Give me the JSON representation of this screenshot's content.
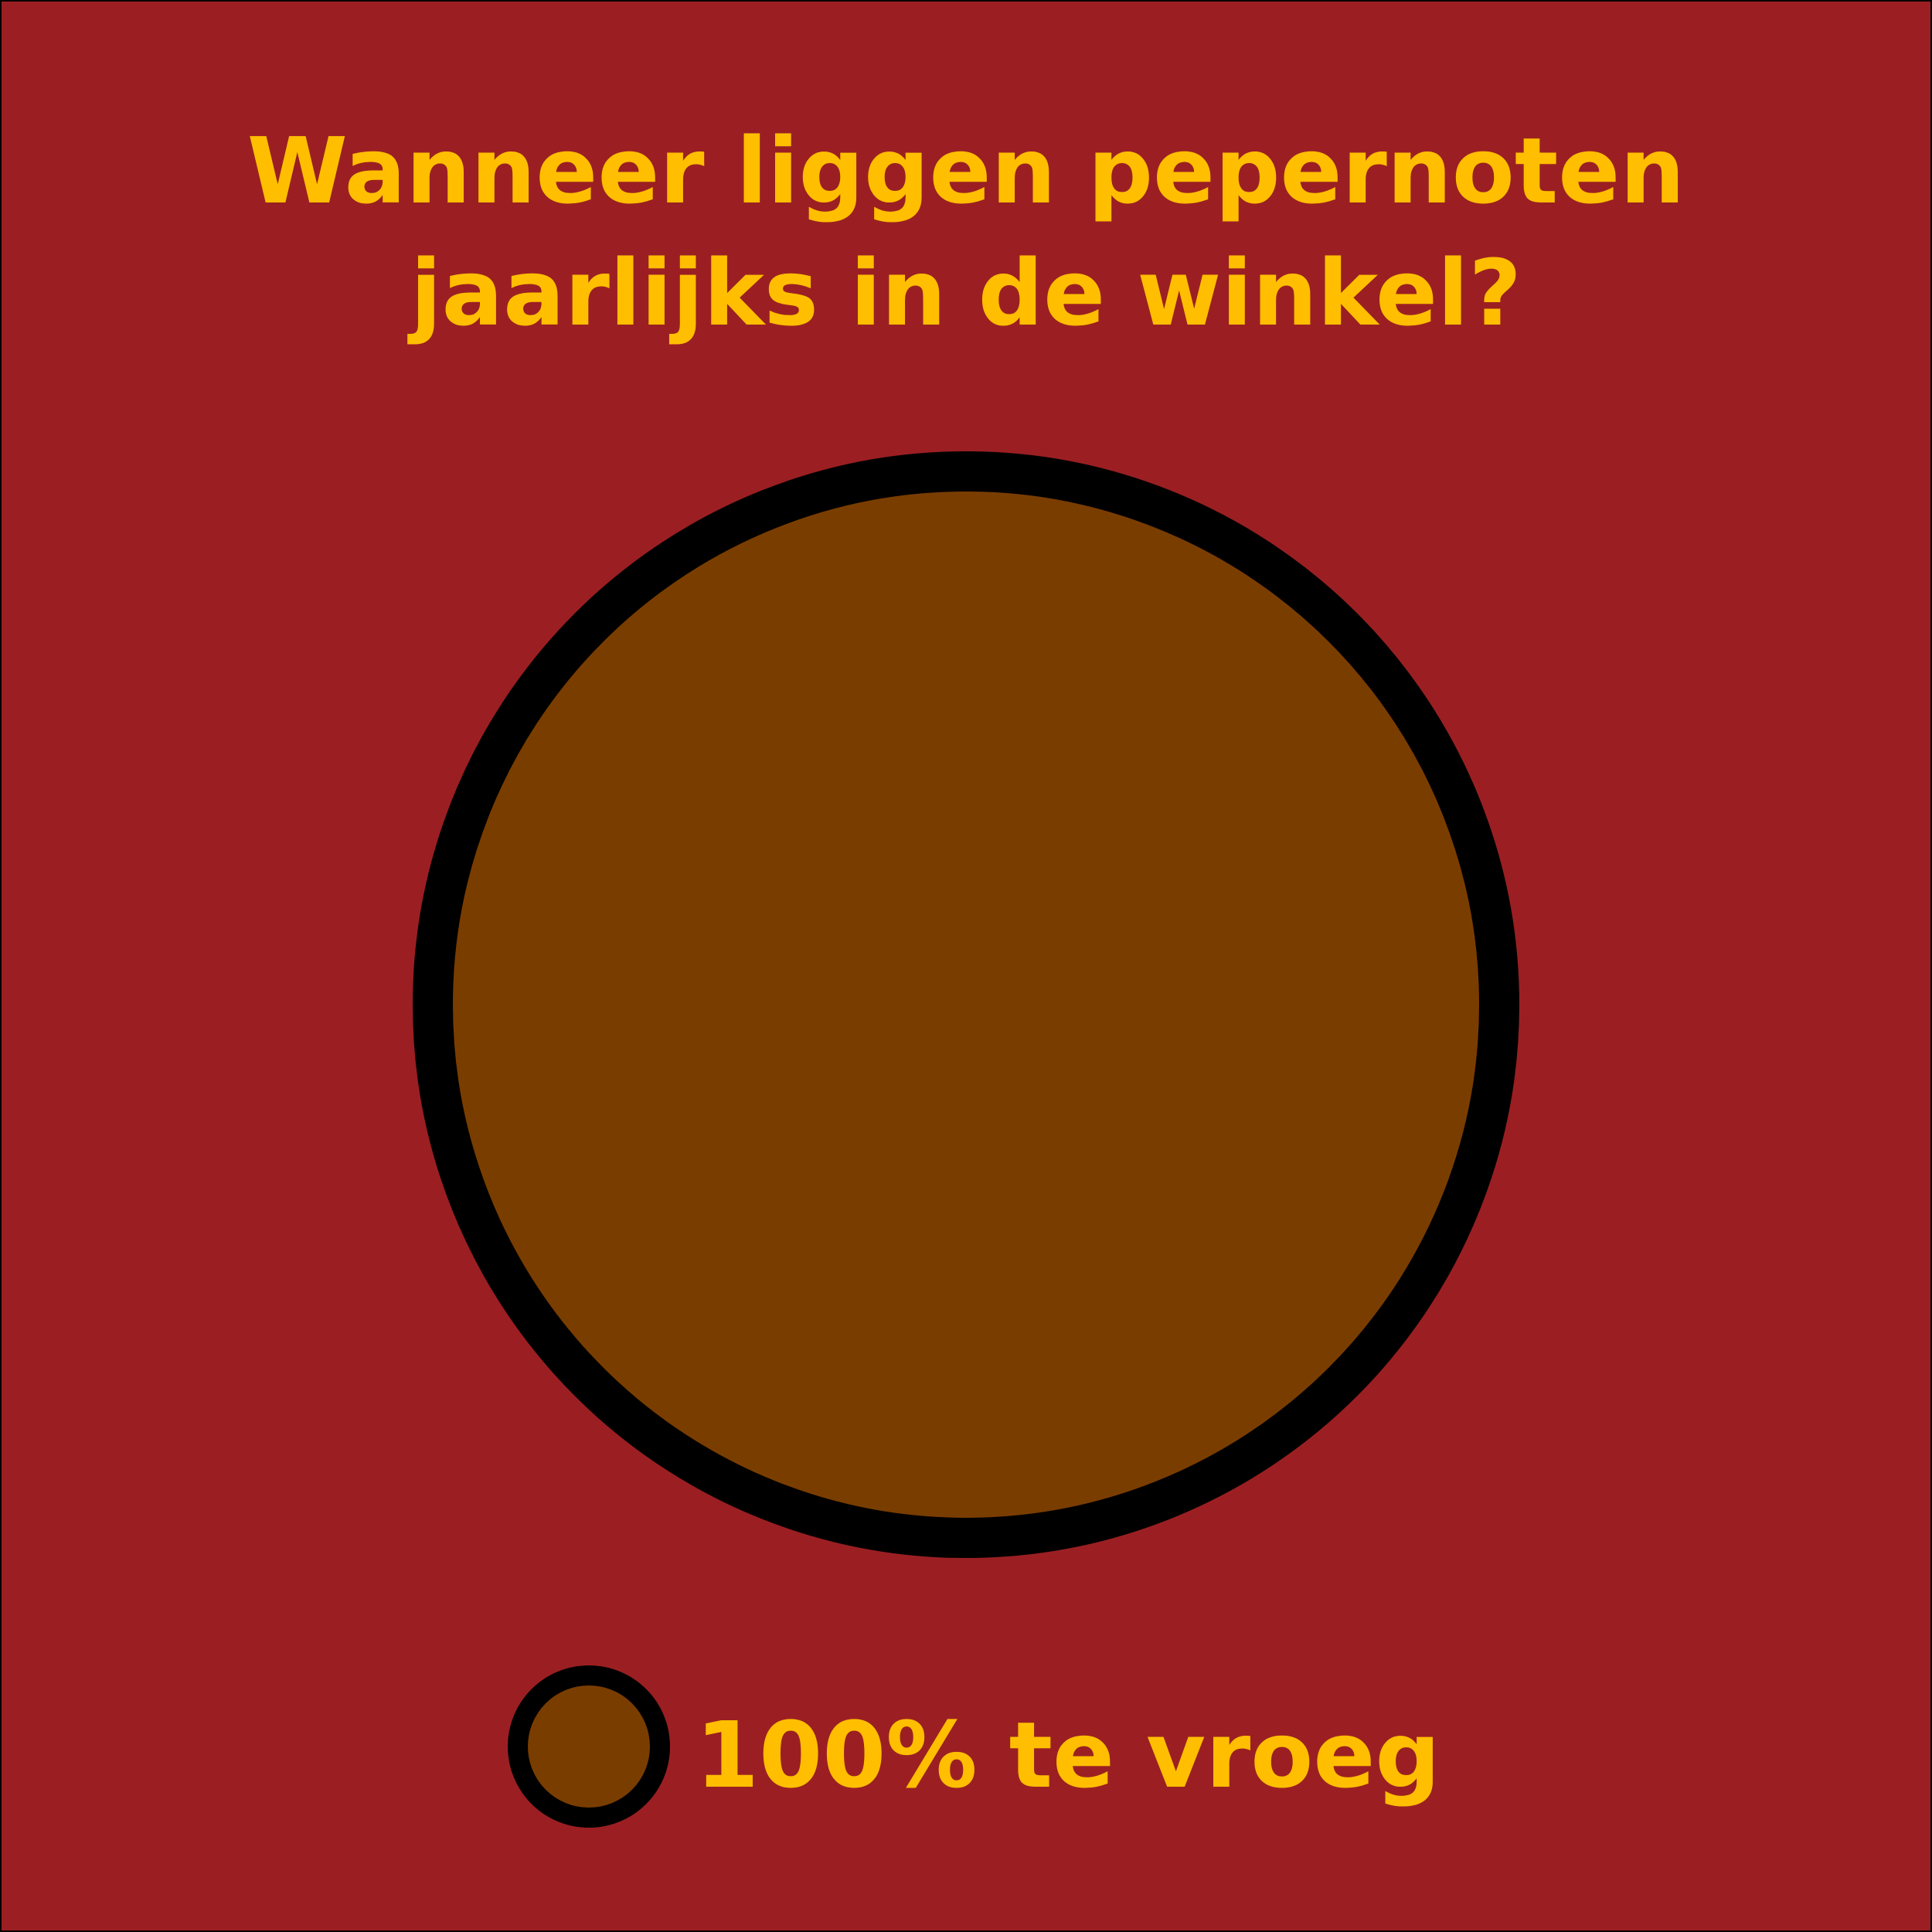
{
  "colors": {
    "background": "#9b1f22",
    "text": "#ffbf00",
    "slice_fill": "#7a3d00",
    "outline": "#000000"
  },
  "chart_data": {
    "type": "pie",
    "title_lines": [
      "Wanneer liggen pepernoten",
      "jaarlijks in de winkel?"
    ],
    "slices": [
      {
        "label": "100% te vroeg",
        "value": 100
      }
    ],
    "legend": {
      "placement": "bottom",
      "entries": [
        "100% te vroeg"
      ]
    }
  }
}
